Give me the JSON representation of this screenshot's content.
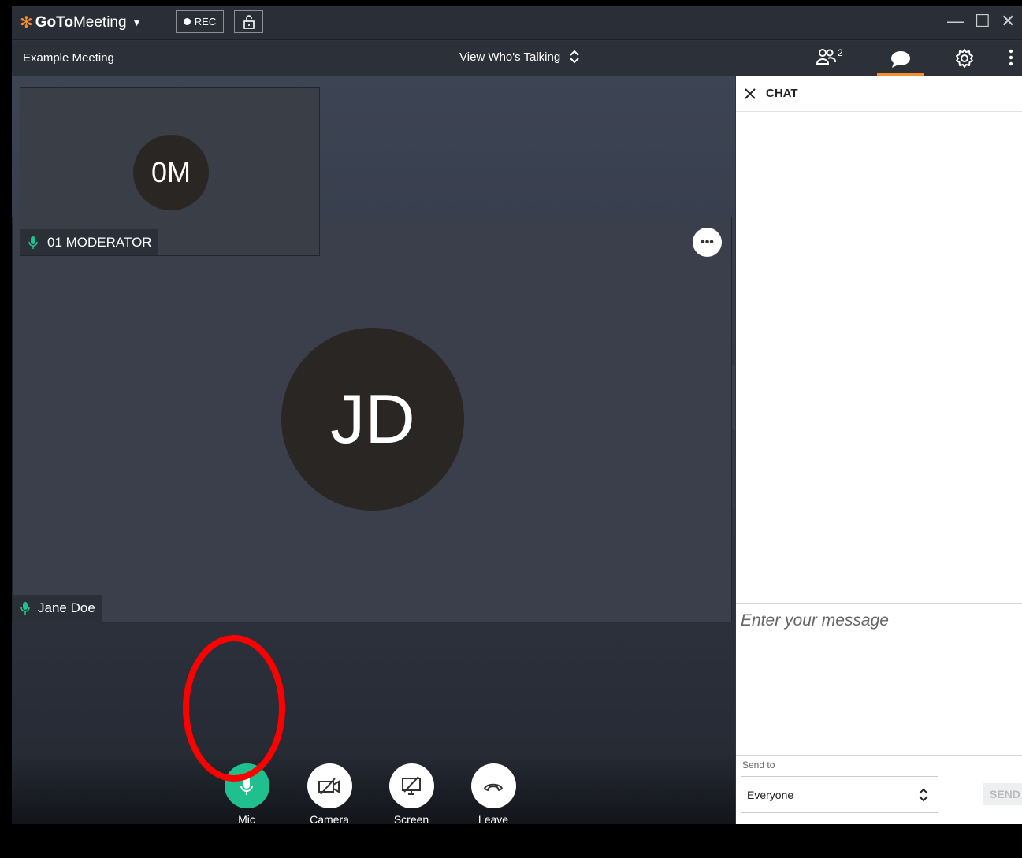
{
  "app": {
    "brand_bold": "GoTo",
    "brand_light": "Meeting",
    "rec_label": "REC"
  },
  "meeting": {
    "title": "Example Meeting",
    "view_mode": "View Who's Talking",
    "people_count": "2"
  },
  "participants": {
    "moderator": {
      "initials": "0M",
      "name": "01 MODERATOR"
    },
    "main": {
      "initials": "JD",
      "name": "Jane Doe"
    }
  },
  "controls": {
    "mic": "Mic",
    "camera": "Camera",
    "screen": "Screen",
    "leave": "Leave"
  },
  "chat": {
    "title": "CHAT",
    "placeholder": "Enter your message",
    "send_to_label": "Send to",
    "send_to_value": "Everyone",
    "send_label": "SEND"
  },
  "colors": {
    "accent": "#f68d2e",
    "mic_active": "#1fc08e",
    "highlight": "#ff0000"
  }
}
